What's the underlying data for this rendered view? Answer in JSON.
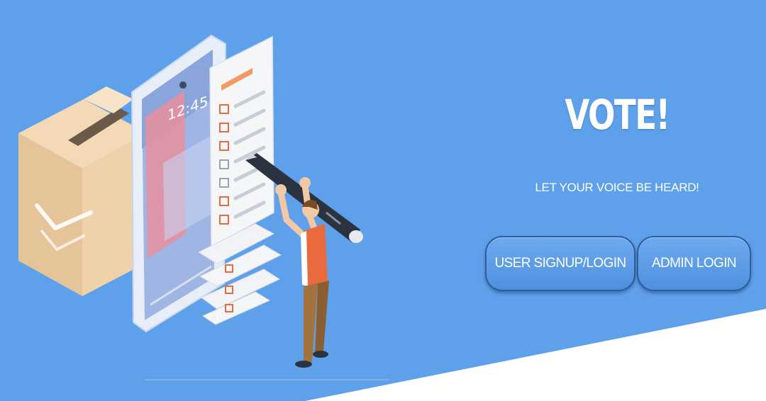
{
  "hero": {
    "title": "VOTE!",
    "tagline": "LET YOUR VOICE BE HEARD!"
  },
  "actions": {
    "user_label": "USER SIGNUP/LOGIN",
    "admin_label": "ADMIN LOGIN"
  },
  "illustration": {
    "phone_clock": "12:45",
    "icons": [
      "ballot-box-icon",
      "smartphone-icon",
      "ballot-list-icon",
      "pen-icon",
      "voter-figure"
    ]
  },
  "colors": {
    "background": "#5ea0ea",
    "button_border": "#2d5f99",
    "accent_orange": "#e86a3e",
    "text": "#ffffff"
  }
}
